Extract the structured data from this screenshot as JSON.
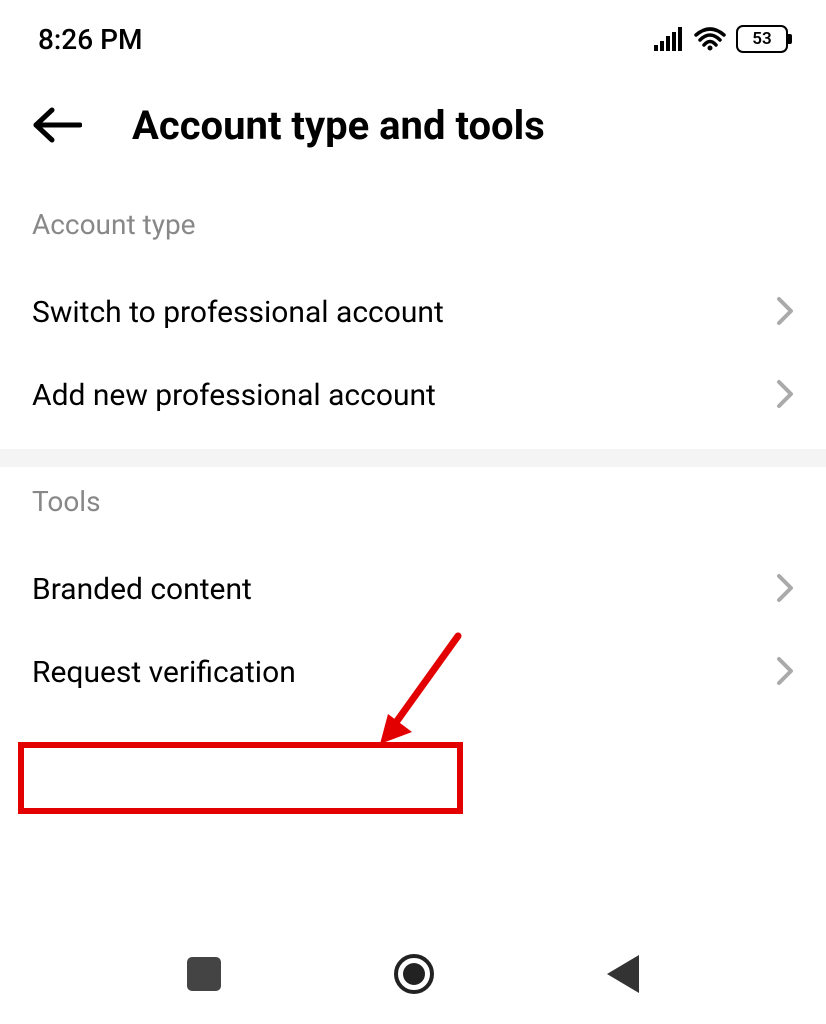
{
  "status": {
    "time": "8:26 PM",
    "battery": "53"
  },
  "header": {
    "title": "Account type and tools"
  },
  "sections": {
    "account_type": {
      "label": "Account type",
      "items": [
        "Switch to professional account",
        "Add new professional account"
      ]
    },
    "tools": {
      "label": "Tools",
      "items": [
        "Branded content",
        "Request verification"
      ]
    }
  },
  "annotation": {
    "highlight_color": "#e30000",
    "highlight_target": "Request verification"
  }
}
